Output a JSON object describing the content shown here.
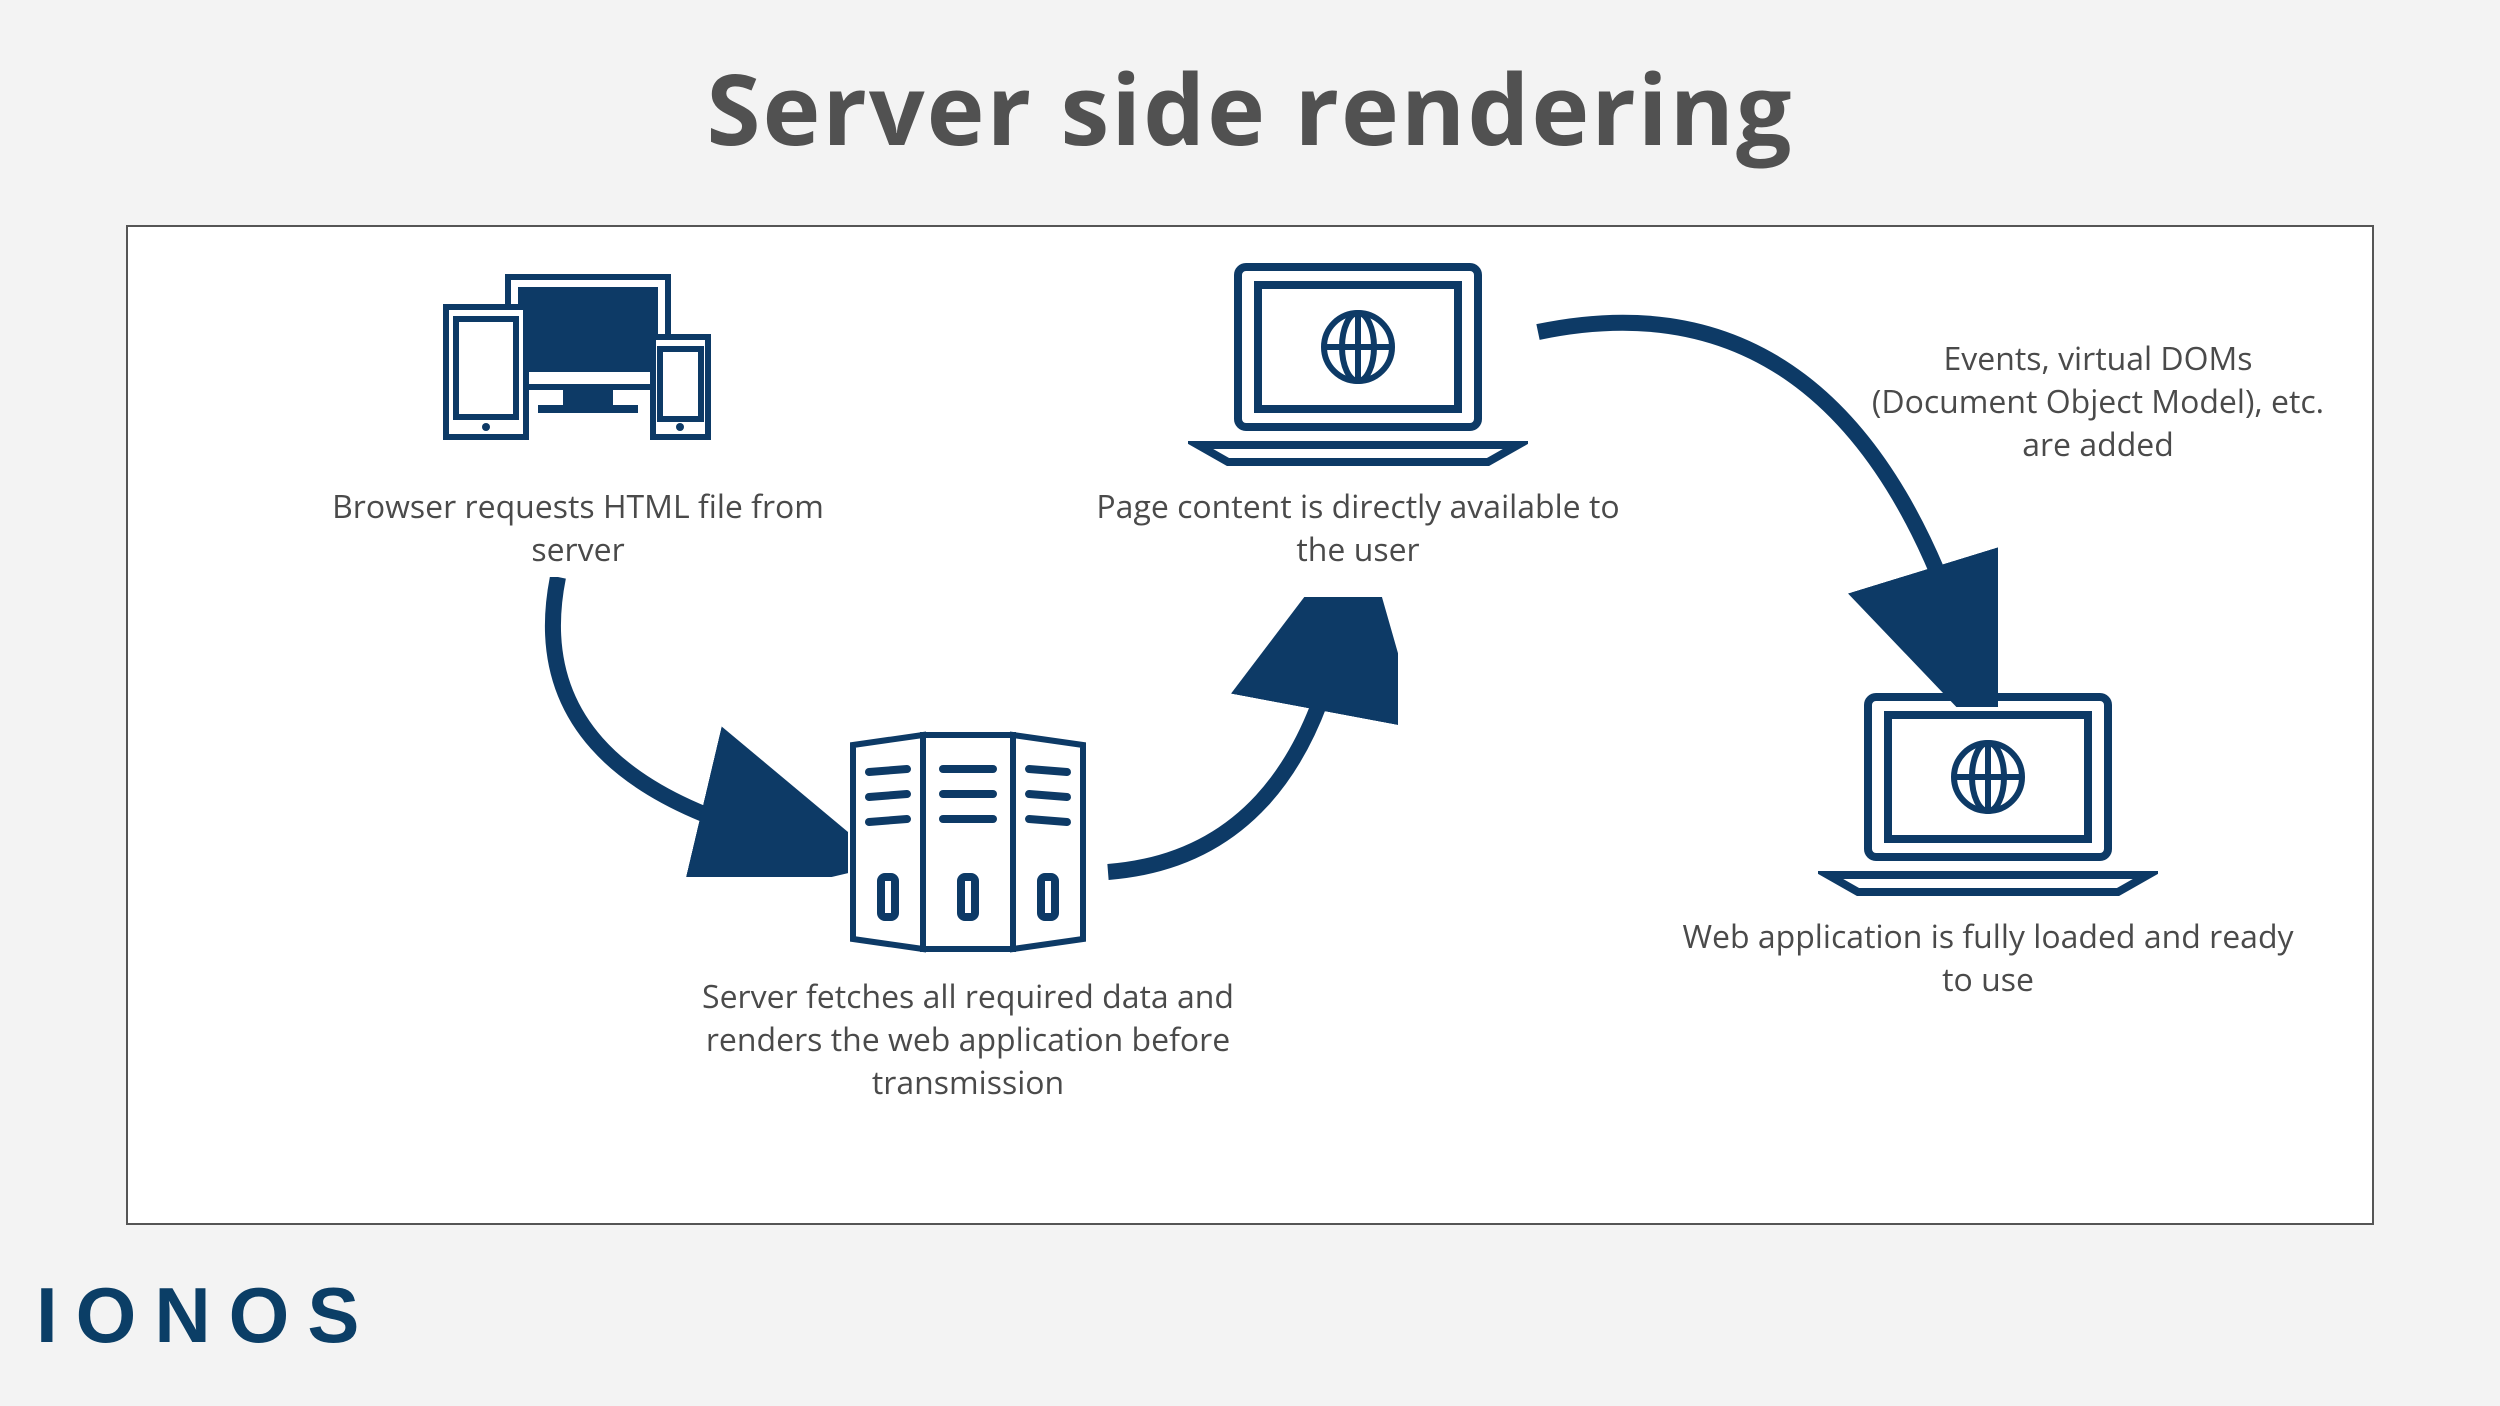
{
  "title": "Server side rendering",
  "logo": "IONOS",
  "steps": {
    "browser_request": "Browser requests HTML file from server",
    "server_render": "Server fetches all required data and renders the web application before transmission",
    "page_available": "Page content is directly available to the user",
    "events_added": "Events, virtual DOMs (Document Object Model), etc. are added",
    "app_ready": "Web application is fully loaded and ready to use"
  },
  "colors": {
    "ink": "#0d3a66",
    "text": "#4a4a4a"
  }
}
